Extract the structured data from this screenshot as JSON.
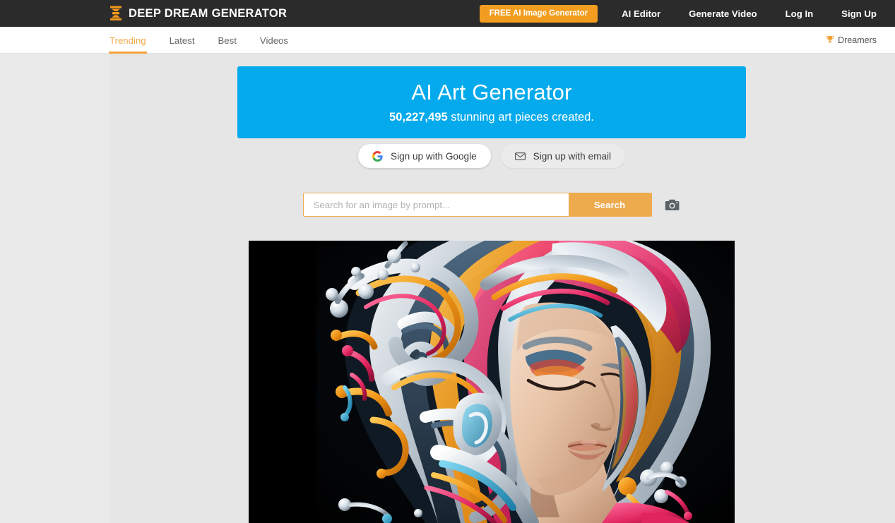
{
  "header": {
    "logo_icon": "hourglass-logo-icon",
    "brand": "DEEP DREAM GENERATOR",
    "cta_label": "FREE AI Image Generator",
    "links": [
      {
        "label": "AI Editor"
      },
      {
        "label": "Generate Video"
      },
      {
        "label": "Log In"
      },
      {
        "label": "Sign Up"
      }
    ],
    "bg_color": "#2b2b2b",
    "cta_color": "#f29d1f"
  },
  "subnav": {
    "tabs": [
      {
        "label": "Trending",
        "active": true
      },
      {
        "label": "Latest",
        "active": false
      },
      {
        "label": "Best",
        "active": false
      },
      {
        "label": "Videos",
        "active": false
      }
    ],
    "dreamers": {
      "icon": "trophy-icon",
      "glyph": "♛",
      "label": "Dreamers"
    },
    "active_color": "#f2a33c"
  },
  "hero": {
    "title": "AI Art Generator",
    "count": "50,227,495",
    "subtitle_rest": " stunning art pieces created.",
    "bg_color": "#04aaec"
  },
  "signup": {
    "google": {
      "icon": "google-g-icon",
      "label": "Sign up with Google"
    },
    "email": {
      "icon": "envelope-icon",
      "label": "Sign up with email"
    }
  },
  "search": {
    "placeholder": "Search for an image by prompt...",
    "value": "",
    "button_label": "Search",
    "camera_icon": "camera-icon",
    "accent_color": "#edab4e"
  },
  "artwork": {
    "alt": "Colorful swirling 3D abstract portrait of a woman with flowing paint hair",
    "background": "#000000"
  }
}
